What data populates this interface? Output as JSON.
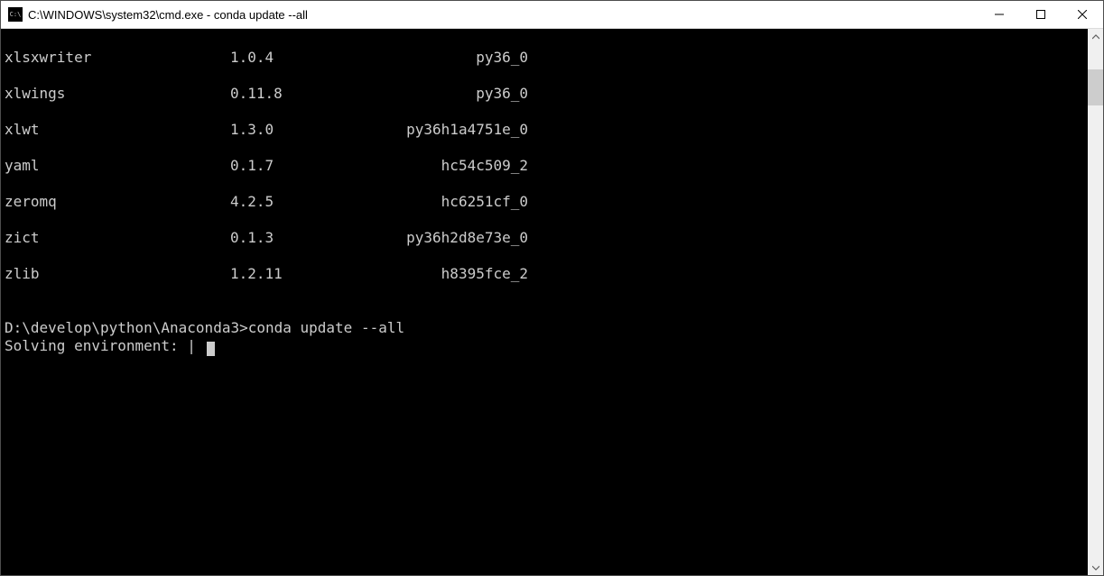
{
  "titlebar": {
    "icon_label": "C:\\",
    "title": "C:\\WINDOWS\\system32\\cmd.exe - conda  update --all"
  },
  "packages": [
    {
      "name": "xlsxwriter",
      "version": "1.0.4",
      "build": "py36_0"
    },
    {
      "name": "xlwings",
      "version": "0.11.8",
      "build": "py36_0"
    },
    {
      "name": "xlwt",
      "version": "1.3.0",
      "build": "py36h1a4751e_0"
    },
    {
      "name": "yaml",
      "version": "0.1.7",
      "build": "hc54c509_2"
    },
    {
      "name": "zeromq",
      "version": "4.2.5",
      "build": "hc6251cf_0"
    },
    {
      "name": "zict",
      "version": "0.1.3",
      "build": "py36h2d8e73e_0"
    },
    {
      "name": "zlib",
      "version": "1.2.11",
      "build": "h8395fce_2"
    }
  ],
  "prompt": {
    "path": "D:\\develop\\python\\Anaconda3>",
    "command": "conda update --all"
  },
  "status": {
    "solving": "Solving environment: ",
    "spinner": "|"
  }
}
